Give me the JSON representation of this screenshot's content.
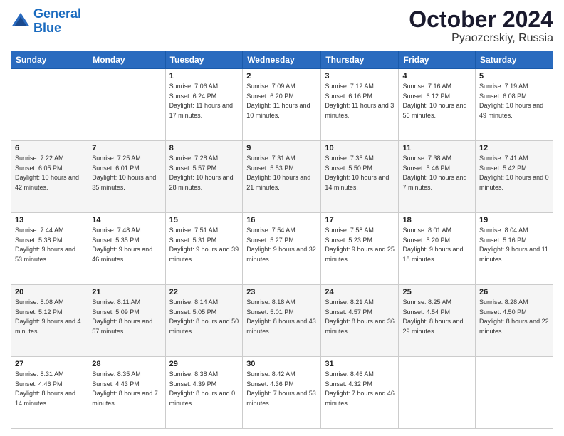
{
  "header": {
    "logo_line1": "General",
    "logo_line2": "Blue",
    "title": "October 2024",
    "subtitle": "Pyaozerskiy, Russia"
  },
  "weekdays": [
    "Sunday",
    "Monday",
    "Tuesday",
    "Wednesday",
    "Thursday",
    "Friday",
    "Saturday"
  ],
  "weeks": [
    [
      {
        "day": "",
        "sunrise": "",
        "sunset": "",
        "daylight": ""
      },
      {
        "day": "",
        "sunrise": "",
        "sunset": "",
        "daylight": ""
      },
      {
        "day": "1",
        "sunrise": "Sunrise: 7:06 AM",
        "sunset": "Sunset: 6:24 PM",
        "daylight": "Daylight: 11 hours and 17 minutes."
      },
      {
        "day": "2",
        "sunrise": "Sunrise: 7:09 AM",
        "sunset": "Sunset: 6:20 PM",
        "daylight": "Daylight: 11 hours and 10 minutes."
      },
      {
        "day": "3",
        "sunrise": "Sunrise: 7:12 AM",
        "sunset": "Sunset: 6:16 PM",
        "daylight": "Daylight: 11 hours and 3 minutes."
      },
      {
        "day": "4",
        "sunrise": "Sunrise: 7:16 AM",
        "sunset": "Sunset: 6:12 PM",
        "daylight": "Daylight: 10 hours and 56 minutes."
      },
      {
        "day": "5",
        "sunrise": "Sunrise: 7:19 AM",
        "sunset": "Sunset: 6:08 PM",
        "daylight": "Daylight: 10 hours and 49 minutes."
      }
    ],
    [
      {
        "day": "6",
        "sunrise": "Sunrise: 7:22 AM",
        "sunset": "Sunset: 6:05 PM",
        "daylight": "Daylight: 10 hours and 42 minutes."
      },
      {
        "day": "7",
        "sunrise": "Sunrise: 7:25 AM",
        "sunset": "Sunset: 6:01 PM",
        "daylight": "Daylight: 10 hours and 35 minutes."
      },
      {
        "day": "8",
        "sunrise": "Sunrise: 7:28 AM",
        "sunset": "Sunset: 5:57 PM",
        "daylight": "Daylight: 10 hours and 28 minutes."
      },
      {
        "day": "9",
        "sunrise": "Sunrise: 7:31 AM",
        "sunset": "Sunset: 5:53 PM",
        "daylight": "Daylight: 10 hours and 21 minutes."
      },
      {
        "day": "10",
        "sunrise": "Sunrise: 7:35 AM",
        "sunset": "Sunset: 5:50 PM",
        "daylight": "Daylight: 10 hours and 14 minutes."
      },
      {
        "day": "11",
        "sunrise": "Sunrise: 7:38 AM",
        "sunset": "Sunset: 5:46 PM",
        "daylight": "Daylight: 10 hours and 7 minutes."
      },
      {
        "day": "12",
        "sunrise": "Sunrise: 7:41 AM",
        "sunset": "Sunset: 5:42 PM",
        "daylight": "Daylight: 10 hours and 0 minutes."
      }
    ],
    [
      {
        "day": "13",
        "sunrise": "Sunrise: 7:44 AM",
        "sunset": "Sunset: 5:38 PM",
        "daylight": "Daylight: 9 hours and 53 minutes."
      },
      {
        "day": "14",
        "sunrise": "Sunrise: 7:48 AM",
        "sunset": "Sunset: 5:35 PM",
        "daylight": "Daylight: 9 hours and 46 minutes."
      },
      {
        "day": "15",
        "sunrise": "Sunrise: 7:51 AM",
        "sunset": "Sunset: 5:31 PM",
        "daylight": "Daylight: 9 hours and 39 minutes."
      },
      {
        "day": "16",
        "sunrise": "Sunrise: 7:54 AM",
        "sunset": "Sunset: 5:27 PM",
        "daylight": "Daylight: 9 hours and 32 minutes."
      },
      {
        "day": "17",
        "sunrise": "Sunrise: 7:58 AM",
        "sunset": "Sunset: 5:23 PM",
        "daylight": "Daylight: 9 hours and 25 minutes."
      },
      {
        "day": "18",
        "sunrise": "Sunrise: 8:01 AM",
        "sunset": "Sunset: 5:20 PM",
        "daylight": "Daylight: 9 hours and 18 minutes."
      },
      {
        "day": "19",
        "sunrise": "Sunrise: 8:04 AM",
        "sunset": "Sunset: 5:16 PM",
        "daylight": "Daylight: 9 hours and 11 minutes."
      }
    ],
    [
      {
        "day": "20",
        "sunrise": "Sunrise: 8:08 AM",
        "sunset": "Sunset: 5:12 PM",
        "daylight": "Daylight: 9 hours and 4 minutes."
      },
      {
        "day": "21",
        "sunrise": "Sunrise: 8:11 AM",
        "sunset": "Sunset: 5:09 PM",
        "daylight": "Daylight: 8 hours and 57 minutes."
      },
      {
        "day": "22",
        "sunrise": "Sunrise: 8:14 AM",
        "sunset": "Sunset: 5:05 PM",
        "daylight": "Daylight: 8 hours and 50 minutes."
      },
      {
        "day": "23",
        "sunrise": "Sunrise: 8:18 AM",
        "sunset": "Sunset: 5:01 PM",
        "daylight": "Daylight: 8 hours and 43 minutes."
      },
      {
        "day": "24",
        "sunrise": "Sunrise: 8:21 AM",
        "sunset": "Sunset: 4:57 PM",
        "daylight": "Daylight: 8 hours and 36 minutes."
      },
      {
        "day": "25",
        "sunrise": "Sunrise: 8:25 AM",
        "sunset": "Sunset: 4:54 PM",
        "daylight": "Daylight: 8 hours and 29 minutes."
      },
      {
        "day": "26",
        "sunrise": "Sunrise: 8:28 AM",
        "sunset": "Sunset: 4:50 PM",
        "daylight": "Daylight: 8 hours and 22 minutes."
      }
    ],
    [
      {
        "day": "27",
        "sunrise": "Sunrise: 8:31 AM",
        "sunset": "Sunset: 4:46 PM",
        "daylight": "Daylight: 8 hours and 14 minutes."
      },
      {
        "day": "28",
        "sunrise": "Sunrise: 8:35 AM",
        "sunset": "Sunset: 4:43 PM",
        "daylight": "Daylight: 8 hours and 7 minutes."
      },
      {
        "day": "29",
        "sunrise": "Sunrise: 8:38 AM",
        "sunset": "Sunset: 4:39 PM",
        "daylight": "Daylight: 8 hours and 0 minutes."
      },
      {
        "day": "30",
        "sunrise": "Sunrise: 8:42 AM",
        "sunset": "Sunset: 4:36 PM",
        "daylight": "Daylight: 7 hours and 53 minutes."
      },
      {
        "day": "31",
        "sunrise": "Sunrise: 8:46 AM",
        "sunset": "Sunset: 4:32 PM",
        "daylight": "Daylight: 7 hours and 46 minutes."
      },
      {
        "day": "",
        "sunrise": "",
        "sunset": "",
        "daylight": ""
      },
      {
        "day": "",
        "sunrise": "",
        "sunset": "",
        "daylight": ""
      }
    ]
  ]
}
